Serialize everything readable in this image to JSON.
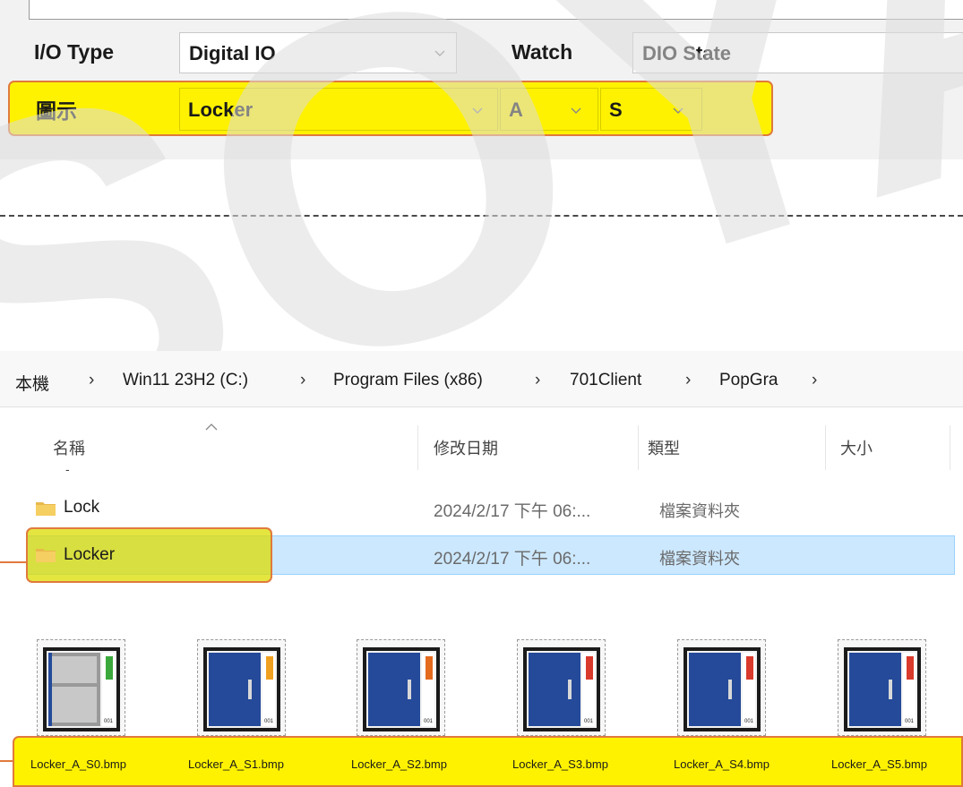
{
  "io_panel": {
    "io_type_label": "I/O Type",
    "io_type_value": "Digital IO",
    "watch_label": "Watch",
    "watch_value": "DIO State",
    "icon_label": "圖示",
    "icon_value": "Locker",
    "letter_value": "A",
    "state_value": "S"
  },
  "watermark": "SOYAL",
  "breadcrumb": [
    "本機",
    "Win11 23H2 (C:)",
    "Program Files (x86)",
    "701Client",
    "PopGra"
  ],
  "breadcrumb_sep": "›",
  "columns": {
    "name": "名稱",
    "modified": "修改日期",
    "type": "類型",
    "size": "大小"
  },
  "rows": [
    {
      "name": "Lock",
      "modified": "2024/2/17 下午 06:...",
      "type": "檔案資料夾",
      "selected": false
    },
    {
      "name": "Locker",
      "modified": "2024/2/17 下午 06:...",
      "type": "檔案資料夾",
      "selected": true
    }
  ],
  "thumbnails": [
    {
      "file": "Locker_A_S0.bmp",
      "state": "open",
      "indicator_color": "#3aa83a"
    },
    {
      "file": "Locker_A_S1.bmp",
      "state": "closed",
      "indicator_color": "#f0a020"
    },
    {
      "file": "Locker_A_S2.bmp",
      "state": "closed",
      "indicator_color": "#e46a1e"
    },
    {
      "file": "Locker_A_S3.bmp",
      "state": "closed",
      "indicator_color": "#d93a2b"
    },
    {
      "file": "Locker_A_S4.bmp",
      "state": "closed",
      "indicator_color": "#d93a2b"
    },
    {
      "file": "Locker_A_S5.bmp",
      "state": "closed",
      "indicator_color": "#d93a2b"
    }
  ],
  "locker_badge": "001",
  "colors": {
    "highlight": "#fff200",
    "callout": "#e07a3c",
    "selection": "#cce8ff",
    "locker_blue": "#254a9a"
  }
}
